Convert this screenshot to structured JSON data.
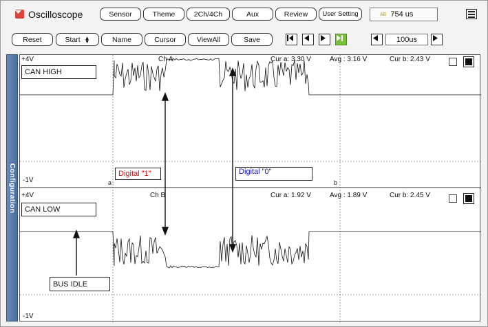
{
  "app": {
    "title": "Oscilloscope"
  },
  "toolbar1": {
    "sensor": "Sensor",
    "theme": "Theme",
    "ch": "2Ch/4Ch",
    "aux": "Aux",
    "review": "Review",
    "user_setting": "User Setting",
    "time_value": "754 us",
    "time_icon": "AB"
  },
  "toolbar2": {
    "reset": "Reset",
    "start": "Start",
    "name": "Name",
    "cursor": "Cursor",
    "viewall": "ViewAll",
    "save": "Save",
    "timebase": "100us"
  },
  "sidebar": {
    "label": "Configuration"
  },
  "ch_a": {
    "scale_top": "+4V",
    "scale_bottom": "-1V",
    "name": "Ch A",
    "tag": "CAN HIGH",
    "cur_a": "Cur a: 3.30 V",
    "avg": "Avg : 3.16 V",
    "cur_b": "Cur b: 2.43 V",
    "cursor_a": "a",
    "cursor_b": "b"
  },
  "ch_b": {
    "scale_top": "+4V",
    "scale_bottom": "-1V",
    "name": "Ch B",
    "tag": "CAN LOW",
    "cur_a": "Cur a: 1.92 V",
    "avg": "Avg : 1.89 V",
    "cur_b": "Cur b: 2.45 V"
  },
  "annotations": {
    "digital1": "Digital \"1\"",
    "digital0": "Digital \"0\"",
    "bus_idle": "BUS IDLE"
  },
  "colors": {
    "digital1": "#d01010",
    "digital0": "#1010c0",
    "sidebar": "#4a6d9e",
    "accent_green": "#7bbf3a"
  }
}
